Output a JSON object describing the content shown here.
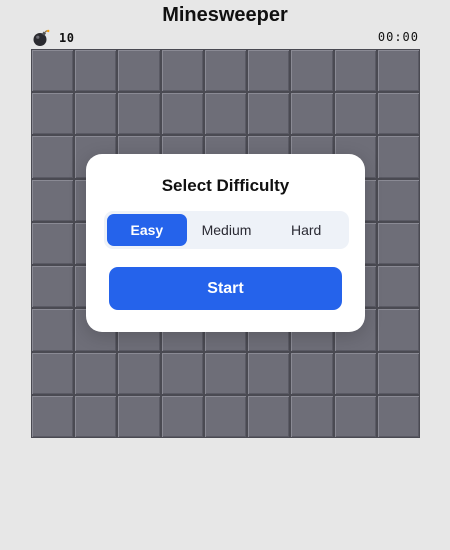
{
  "header": {
    "title": "Minesweeper"
  },
  "status": {
    "mine_count": "10",
    "timer": "00:00",
    "mine_icon": "bomb-icon"
  },
  "board": {
    "rows": 9,
    "cols": 9,
    "cell_state": "covered"
  },
  "dialog": {
    "title": "Select Difficulty",
    "options": [
      {
        "label": "Easy",
        "selected": true
      },
      {
        "label": "Medium",
        "selected": false
      },
      {
        "label": "Hard",
        "selected": false
      }
    ],
    "start_label": "Start"
  },
  "colors": {
    "accent": "#2563eb",
    "cell": "#6e6e78",
    "background": "#e7e7e7"
  }
}
